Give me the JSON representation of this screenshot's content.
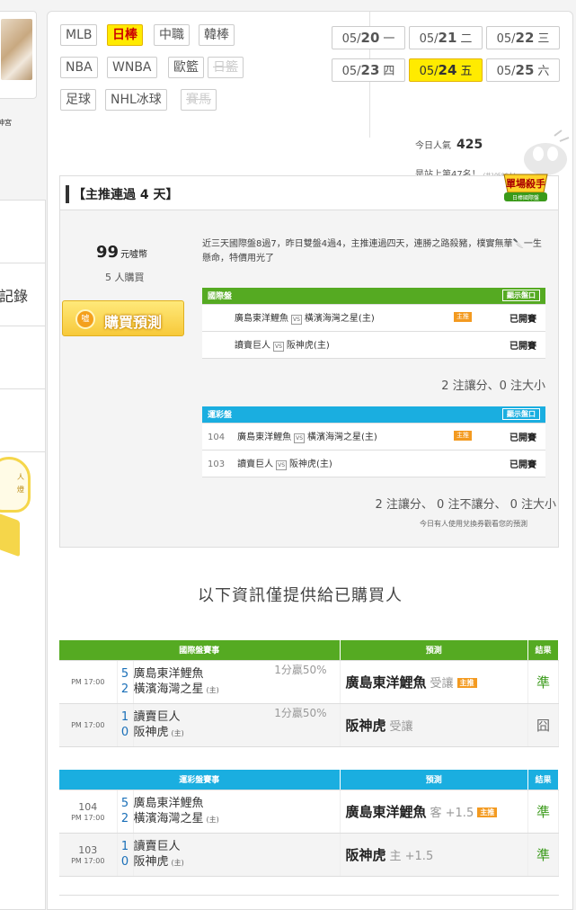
{
  "side": {
    "caption": "神宮",
    "record_label": "記錄",
    "bulb_text": [
      "人",
      "燈"
    ]
  },
  "sports_tags": [
    {
      "label": "MLB",
      "state": "normal"
    },
    {
      "label": "日棒",
      "state": "active"
    },
    {
      "label": "中職",
      "state": "normal"
    },
    {
      "label": "韓棒",
      "state": "normal"
    },
    {
      "label": "NBA",
      "state": "normal"
    },
    {
      "label": "WNBA",
      "state": "normal"
    },
    {
      "label": "歐籃",
      "state": "normal"
    },
    {
      "label": "日籃",
      "state": "disabled"
    },
    {
      "label": "足球",
      "state": "normal"
    },
    {
      "label": "NHL冰球",
      "state": "normal"
    },
    {
      "label": "賽馬",
      "state": "disabled"
    }
  ],
  "dates": [
    {
      "date": "05/",
      "day": "20",
      "wd": "一",
      "active": false
    },
    {
      "date": "05/",
      "day": "21",
      "wd": "二",
      "active": false
    },
    {
      "date": "05/",
      "day": "22",
      "wd": "三",
      "active": false
    },
    {
      "date": "05/",
      "day": "23",
      "wd": "四",
      "active": false
    },
    {
      "date": "05/",
      "day": "24",
      "wd": "五",
      "active": true
    },
    {
      "date": "05/",
      "day": "25",
      "wd": "六",
      "active": false
    }
  ],
  "popularity": {
    "label": "今日人氣",
    "value": "425",
    "rank_text": "是站上第47名！",
    "rank_total": "(共10586人)"
  },
  "pick": {
    "title": "【主推連過 4 天】",
    "badge_main": "單場殺手",
    "badge_sub": "日棒國際盤",
    "price": "99",
    "price_unit": "元噓幣",
    "buyers": "5 人購買",
    "buy_label": "購買預測",
    "buy_coin": "噓",
    "description": "近三天國際盤8過7，昨日雙盤4過4，主推連過四天，連勝之路殺豬，樸實無華🔪一生懸命，特價用光了",
    "intl": {
      "header": "國際盤",
      "show_label": "顯示盤口",
      "rows": [
        {
          "home": "廣島東洋鯉魚",
          "vs": "VS",
          "away": "橫濱海灣之星(主)",
          "badge": "主推",
          "status": "已開賽"
        },
        {
          "home": "讀賣巨人",
          "vs": "VS",
          "away": "阪神虎(主)",
          "badge": "",
          "status": "已開賽"
        }
      ],
      "summary": "2 注讓分、0 注大小"
    },
    "lottery": {
      "header": "運彩盤",
      "show_label": "顯示盤口",
      "rows": [
        {
          "no": "104",
          "home": "廣島東洋鯉魚",
          "vs": "VS",
          "away": "橫濱海灣之星(主)",
          "badge": "主推",
          "status": "已開賽"
        },
        {
          "no": "103",
          "home": "讀賣巨人",
          "vs": "VS",
          "away": "阪神虎(主)",
          "badge": "",
          "status": "已開賽"
        }
      ],
      "summary": "2 注讓分、 0 注不讓分、 0 注大小"
    },
    "note": "今日有人使用兌換券觀看您的預測"
  },
  "buyers_info": "以下資訊僅提供給已購買人",
  "results_intl": {
    "headers": {
      "game": "國際盤賽事",
      "pred": "預測",
      "res": "結果"
    },
    "rows": [
      {
        "time": "PM 17:00",
        "s1": "5",
        "s2": "2",
        "t1": "廣島東洋鯉魚",
        "t2": "橫濱海灣之星",
        "t2host": "(主)",
        "odds": "1分贏50%",
        "pred": "廣島東洋鯉魚",
        "pred_sub": "受讓",
        "badge": "主推",
        "result": "準",
        "ok": true
      },
      {
        "time": "PM 17:00",
        "s1": "1",
        "s2": "0",
        "t1": "讀賣巨人",
        "t2": "阪神虎",
        "t2host": "(主)",
        "odds": "1分贏50%",
        "pred": "阪神虎",
        "pred_sub": "受讓",
        "badge": "",
        "result": "囧",
        "ok": false
      }
    ]
  },
  "results_lottery": {
    "headers": {
      "game": "運彩盤賽事",
      "pred": "預測",
      "res": "結果"
    },
    "rows": [
      {
        "no": "104",
        "time": "PM 17:00",
        "s1": "5",
        "s2": "2",
        "t1": "廣島東洋鯉魚",
        "t2": "橫濱海灣之星",
        "t2host": "(主)",
        "pred": "廣島東洋鯉魚",
        "pred_sub": "客 +1.5",
        "badge": "主推",
        "result": "準",
        "ok": true
      },
      {
        "no": "103",
        "time": "PM 17:00",
        "s1": "1",
        "s2": "0",
        "t1": "讀賣巨人",
        "t2": "阪神虎",
        "t2host": "(主)",
        "pred": "阪神虎",
        "pred_sub": "主 +1.5",
        "badge": "",
        "result": "準",
        "ok": true
      }
    ]
  },
  "colors": {
    "active_yellow": "#ffeb00",
    "green": "#55aa22",
    "blue": "#1aaee0",
    "win": "#3a9a1a"
  }
}
